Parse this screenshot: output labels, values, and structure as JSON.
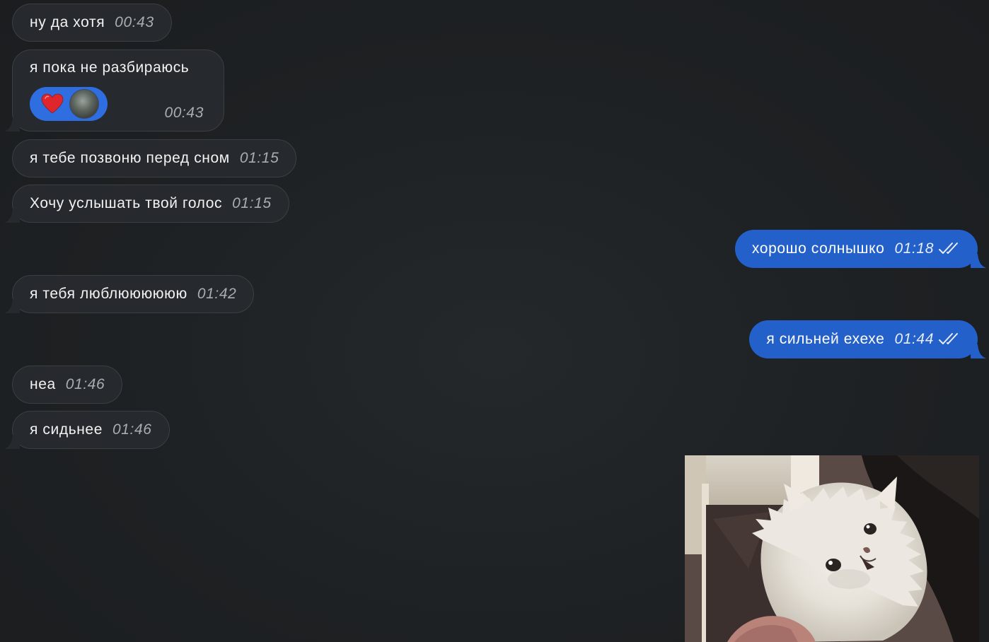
{
  "messages": [
    {
      "direction": "in",
      "text": "ну да хотя",
      "time": "00:43"
    },
    {
      "direction": "in",
      "text": "я пока не разбираюсь",
      "time": "00:43",
      "reaction": "heart-emoji"
    },
    {
      "direction": "in",
      "text": "я тебе позвоню перед сном",
      "time": "01:15"
    },
    {
      "direction": "in",
      "text": "Хочу услышать твой голос",
      "time": "01:15"
    },
    {
      "direction": "out",
      "text": "хорошо солнышко",
      "time": "01:18",
      "status": "read-double-check-icon"
    },
    {
      "direction": "in",
      "text": "я тебя люблюююююю",
      "time": "01:42"
    },
    {
      "direction": "out",
      "text": "я сильней ехехе",
      "time": "01:44",
      "status": "read-double-check-icon"
    },
    {
      "direction": "in",
      "text": "неа",
      "time": "01:46"
    },
    {
      "direction": "in",
      "text": "я сидьнее",
      "time": "01:46"
    }
  ],
  "media": {
    "type": "photo",
    "subject": "kitten"
  },
  "colors": {
    "background": "#1d2022",
    "incoming_bubble": "#262a2e",
    "outgoing_bubble": "#2360c9",
    "reaction_pill": "#2f6ee0"
  }
}
